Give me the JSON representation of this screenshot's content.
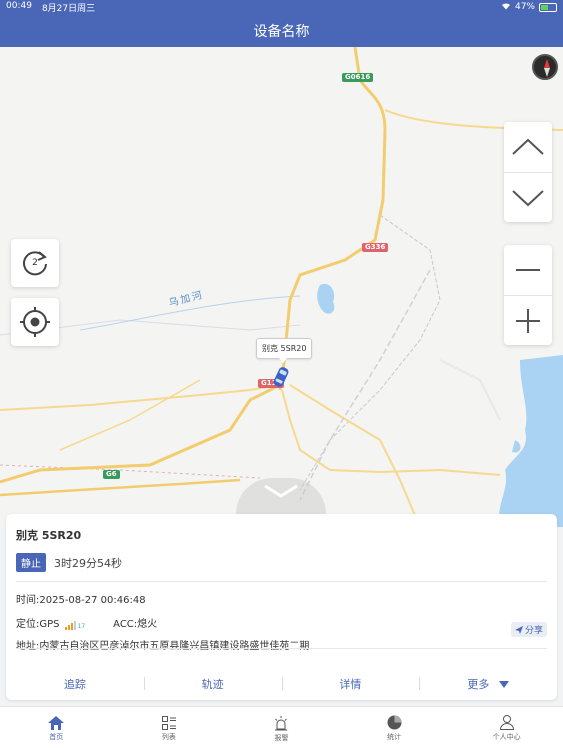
{
  "status_bar": {
    "time": "00:49",
    "date": "8月27日周三",
    "battery": "47%"
  },
  "nav": {
    "title": "设备名称"
  },
  "map": {
    "road_shields": [
      {
        "label": "G0616",
        "color": "green"
      },
      {
        "label": "G336",
        "color": "red"
      },
      {
        "label": "G110",
        "color": "red"
      },
      {
        "label": "G6",
        "color": "green"
      }
    ],
    "river_label": "乌加河",
    "vehicle_label": "别克 5SR20",
    "refresh_count": "2",
    "icons": [
      "compass-icon",
      "chevron-up-icon",
      "chevron-down-icon",
      "zoom-out-icon",
      "zoom-in-icon",
      "refresh-icon",
      "locate-icon",
      "car-icon"
    ]
  },
  "card": {
    "plate": "别克 5SR20",
    "status_tag": "静止",
    "duration": "3时29分54秒",
    "time_label": "时间:",
    "time_value": "2025-08-27 00:46:48",
    "locate_label": "定位:",
    "locate_value": "GPS",
    "satellites": "17",
    "acc_label": "ACC:",
    "acc_value": "熄火",
    "address_label": "地址:",
    "address_value": "内蒙古自治区巴彦淖尔市五原县隆兴昌镇建设路盛世佳苑二期",
    "share_label": "分享",
    "actions": [
      "追踪",
      "轨迹",
      "详情",
      "更多"
    ]
  },
  "tabs": [
    {
      "label": "首页",
      "icon": "home-icon",
      "active": true
    },
    {
      "label": "列表",
      "icon": "list-icon"
    },
    {
      "label": "报警",
      "icon": "alarm-icon"
    },
    {
      "label": "统计",
      "icon": "chart-icon"
    },
    {
      "label": "个人中心",
      "icon": "user-icon"
    }
  ],
  "colors": {
    "primary": "#4a67b7",
    "status_green": "#5fd35a"
  }
}
